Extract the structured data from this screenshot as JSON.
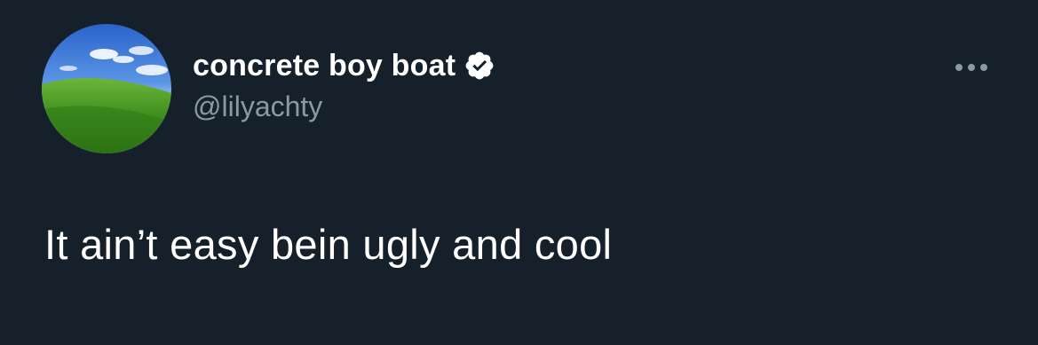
{
  "tweet": {
    "author": {
      "display_name": "concrete boy boat",
      "handle": "@lilyachty",
      "verified": true,
      "avatar_icon": "green-hill-landscape-avatar"
    },
    "more_icon": "ellipsis-horizontal-icon",
    "verified_icon": "verified-badge-icon",
    "text": "It ain’t easy bein ugly and cool"
  },
  "colors": {
    "background": "#15202b",
    "primary_text": "#ffffff",
    "secondary_text": "#8b98a5",
    "verified_badge": "#ffffff"
  }
}
